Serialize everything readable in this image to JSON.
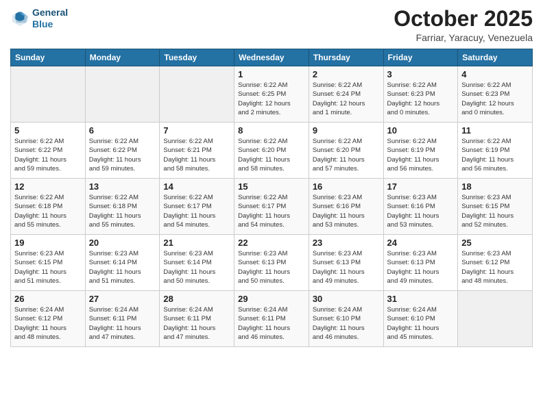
{
  "logo": {
    "text1": "General",
    "text2": "Blue"
  },
  "title": "October 2025",
  "location": "Farriar, Yaracuy, Venezuela",
  "headers": [
    "Sunday",
    "Monday",
    "Tuesday",
    "Wednesday",
    "Thursday",
    "Friday",
    "Saturday"
  ],
  "weeks": [
    [
      {
        "day": "",
        "info": ""
      },
      {
        "day": "",
        "info": ""
      },
      {
        "day": "",
        "info": ""
      },
      {
        "day": "1",
        "info": "Sunrise: 6:22 AM\nSunset: 6:25 PM\nDaylight: 12 hours\nand 2 minutes."
      },
      {
        "day": "2",
        "info": "Sunrise: 6:22 AM\nSunset: 6:24 PM\nDaylight: 12 hours\nand 1 minute."
      },
      {
        "day": "3",
        "info": "Sunrise: 6:22 AM\nSunset: 6:23 PM\nDaylight: 12 hours\nand 0 minutes."
      },
      {
        "day": "4",
        "info": "Sunrise: 6:22 AM\nSunset: 6:23 PM\nDaylight: 12 hours\nand 0 minutes."
      }
    ],
    [
      {
        "day": "5",
        "info": "Sunrise: 6:22 AM\nSunset: 6:22 PM\nDaylight: 11 hours\nand 59 minutes."
      },
      {
        "day": "6",
        "info": "Sunrise: 6:22 AM\nSunset: 6:22 PM\nDaylight: 11 hours\nand 59 minutes."
      },
      {
        "day": "7",
        "info": "Sunrise: 6:22 AM\nSunset: 6:21 PM\nDaylight: 11 hours\nand 58 minutes."
      },
      {
        "day": "8",
        "info": "Sunrise: 6:22 AM\nSunset: 6:20 PM\nDaylight: 11 hours\nand 58 minutes."
      },
      {
        "day": "9",
        "info": "Sunrise: 6:22 AM\nSunset: 6:20 PM\nDaylight: 11 hours\nand 57 minutes."
      },
      {
        "day": "10",
        "info": "Sunrise: 6:22 AM\nSunset: 6:19 PM\nDaylight: 11 hours\nand 56 minutes."
      },
      {
        "day": "11",
        "info": "Sunrise: 6:22 AM\nSunset: 6:19 PM\nDaylight: 11 hours\nand 56 minutes."
      }
    ],
    [
      {
        "day": "12",
        "info": "Sunrise: 6:22 AM\nSunset: 6:18 PM\nDaylight: 11 hours\nand 55 minutes."
      },
      {
        "day": "13",
        "info": "Sunrise: 6:22 AM\nSunset: 6:18 PM\nDaylight: 11 hours\nand 55 minutes."
      },
      {
        "day": "14",
        "info": "Sunrise: 6:22 AM\nSunset: 6:17 PM\nDaylight: 11 hours\nand 54 minutes."
      },
      {
        "day": "15",
        "info": "Sunrise: 6:22 AM\nSunset: 6:17 PM\nDaylight: 11 hours\nand 54 minutes."
      },
      {
        "day": "16",
        "info": "Sunrise: 6:23 AM\nSunset: 6:16 PM\nDaylight: 11 hours\nand 53 minutes."
      },
      {
        "day": "17",
        "info": "Sunrise: 6:23 AM\nSunset: 6:16 PM\nDaylight: 11 hours\nand 53 minutes."
      },
      {
        "day": "18",
        "info": "Sunrise: 6:23 AM\nSunset: 6:15 PM\nDaylight: 11 hours\nand 52 minutes."
      }
    ],
    [
      {
        "day": "19",
        "info": "Sunrise: 6:23 AM\nSunset: 6:15 PM\nDaylight: 11 hours\nand 51 minutes."
      },
      {
        "day": "20",
        "info": "Sunrise: 6:23 AM\nSunset: 6:14 PM\nDaylight: 11 hours\nand 51 minutes."
      },
      {
        "day": "21",
        "info": "Sunrise: 6:23 AM\nSunset: 6:14 PM\nDaylight: 11 hours\nand 50 minutes."
      },
      {
        "day": "22",
        "info": "Sunrise: 6:23 AM\nSunset: 6:13 PM\nDaylight: 11 hours\nand 50 minutes."
      },
      {
        "day": "23",
        "info": "Sunrise: 6:23 AM\nSunset: 6:13 PM\nDaylight: 11 hours\nand 49 minutes."
      },
      {
        "day": "24",
        "info": "Sunrise: 6:23 AM\nSunset: 6:13 PM\nDaylight: 11 hours\nand 49 minutes."
      },
      {
        "day": "25",
        "info": "Sunrise: 6:23 AM\nSunset: 6:12 PM\nDaylight: 11 hours\nand 48 minutes."
      }
    ],
    [
      {
        "day": "26",
        "info": "Sunrise: 6:24 AM\nSunset: 6:12 PM\nDaylight: 11 hours\nand 48 minutes."
      },
      {
        "day": "27",
        "info": "Sunrise: 6:24 AM\nSunset: 6:11 PM\nDaylight: 11 hours\nand 47 minutes."
      },
      {
        "day": "28",
        "info": "Sunrise: 6:24 AM\nSunset: 6:11 PM\nDaylight: 11 hours\nand 47 minutes."
      },
      {
        "day": "29",
        "info": "Sunrise: 6:24 AM\nSunset: 6:11 PM\nDaylight: 11 hours\nand 46 minutes."
      },
      {
        "day": "30",
        "info": "Sunrise: 6:24 AM\nSunset: 6:10 PM\nDaylight: 11 hours\nand 46 minutes."
      },
      {
        "day": "31",
        "info": "Sunrise: 6:24 AM\nSunset: 6:10 PM\nDaylight: 11 hours\nand 45 minutes."
      },
      {
        "day": "",
        "info": ""
      }
    ]
  ]
}
